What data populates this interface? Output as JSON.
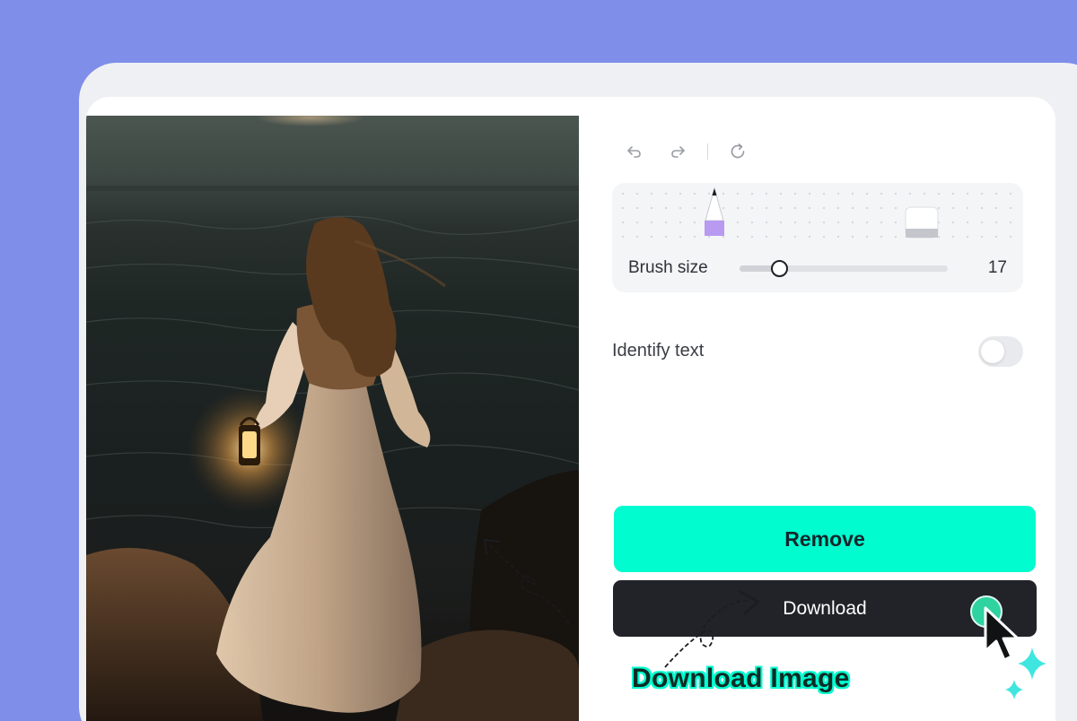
{
  "toolbar": {
    "undo_icon": "undo-icon",
    "redo_icon": "redo-icon",
    "reset_icon": "reset-icon"
  },
  "brush": {
    "label": "Brush size",
    "value": "17",
    "level": 0.19,
    "pencil_color": "#b89af0",
    "tools": [
      "pencil-icon",
      "eraser-icon"
    ]
  },
  "identify_text": {
    "label": "Identify text",
    "enabled": false
  },
  "actions": {
    "remove_label": "Remove",
    "download_label": "Download"
  },
  "annotation": {
    "label": "Download Image"
  },
  "colors": {
    "background": "#7f8ee9",
    "accent": "#00fccf",
    "download_button": "#212328",
    "click_indicator": "#2fd3a0"
  }
}
